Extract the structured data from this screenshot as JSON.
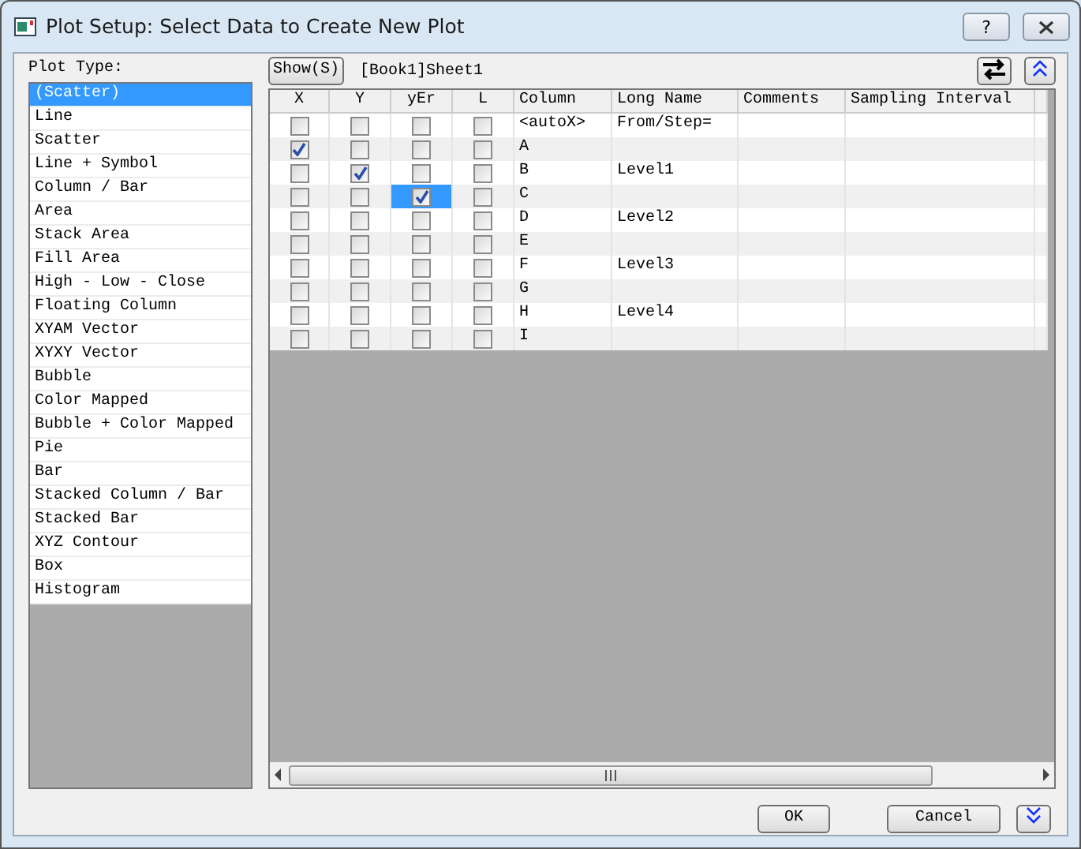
{
  "window": {
    "title": "Plot Setup: Select Data to Create New Plot",
    "help_button": "?"
  },
  "plot_type": {
    "label": "Plot Type:",
    "items": [
      {
        "label": "(Scatter)",
        "selected": true
      },
      {
        "label": "Line",
        "selected": false
      },
      {
        "label": "Scatter",
        "selected": false
      },
      {
        "label": "Line + Symbol",
        "selected": false
      },
      {
        "label": "Column / Bar",
        "selected": false
      },
      {
        "label": "Area",
        "selected": false
      },
      {
        "label": "Stack Area",
        "selected": false
      },
      {
        "label": "Fill Area",
        "selected": false
      },
      {
        "label": "High - Low - Close",
        "selected": false
      },
      {
        "label": "Floating Column",
        "selected": false
      },
      {
        "label": "XYAM Vector",
        "selected": false
      },
      {
        "label": "XYXY Vector",
        "selected": false
      },
      {
        "label": "Bubble",
        "selected": false
      },
      {
        "label": "Color Mapped",
        "selected": false
      },
      {
        "label": "Bubble + Color Mapped",
        "selected": false
      },
      {
        "label": "Pie",
        "selected": false
      },
      {
        "label": "Bar",
        "selected": false
      },
      {
        "label": "Stacked Column / Bar",
        "selected": false
      },
      {
        "label": "Stacked Bar",
        "selected": false
      },
      {
        "label": "XYZ Contour",
        "selected": false
      },
      {
        "label": "Box",
        "selected": false
      },
      {
        "label": "Histogram",
        "selected": false
      }
    ]
  },
  "toolbar": {
    "show_button": "Show(S)",
    "sheet": "[Book1]Sheet1"
  },
  "table": {
    "columns": [
      "X",
      "Y",
      "yEr",
      "L",
      "Column",
      "Long Name",
      "Comments",
      "Sampling Interval"
    ],
    "rows": [
      {
        "checks": [
          {
            "checked": false,
            "selected": false
          },
          {
            "checked": false,
            "selected": false
          },
          {
            "checked": false,
            "selected": false
          },
          {
            "checked": false,
            "selected": false
          }
        ],
        "column": "<autoX>",
        "long_name": "From/Step="
      },
      {
        "checks": [
          {
            "checked": true,
            "selected": false
          },
          {
            "checked": false,
            "selected": false
          },
          {
            "checked": false,
            "selected": false
          },
          {
            "checked": false,
            "selected": false
          }
        ],
        "column": "A",
        "long_name": ""
      },
      {
        "checks": [
          {
            "checked": false,
            "selected": false
          },
          {
            "checked": true,
            "selected": false
          },
          {
            "checked": false,
            "selected": false
          },
          {
            "checked": false,
            "selected": false
          }
        ],
        "column": "B",
        "long_name": "Level1"
      },
      {
        "checks": [
          {
            "checked": false,
            "selected": false
          },
          {
            "checked": false,
            "selected": false
          },
          {
            "checked": true,
            "selected": true
          },
          {
            "checked": false,
            "selected": false
          }
        ],
        "column": "C",
        "long_name": ""
      },
      {
        "checks": [
          {
            "checked": false,
            "selected": false
          },
          {
            "checked": false,
            "selected": false
          },
          {
            "checked": false,
            "selected": false
          },
          {
            "checked": false,
            "selected": false
          }
        ],
        "column": "D",
        "long_name": "Level2"
      },
      {
        "checks": [
          {
            "checked": false,
            "selected": false
          },
          {
            "checked": false,
            "selected": false
          },
          {
            "checked": false,
            "selected": false
          },
          {
            "checked": false,
            "selected": false
          }
        ],
        "column": "E",
        "long_name": ""
      },
      {
        "checks": [
          {
            "checked": false,
            "selected": false
          },
          {
            "checked": false,
            "selected": false
          },
          {
            "checked": false,
            "selected": false
          },
          {
            "checked": false,
            "selected": false
          }
        ],
        "column": "F",
        "long_name": "Level3"
      },
      {
        "checks": [
          {
            "checked": false,
            "selected": false
          },
          {
            "checked": false,
            "selected": false
          },
          {
            "checked": false,
            "selected": false
          },
          {
            "checked": false,
            "selected": false
          }
        ],
        "column": "G",
        "long_name": ""
      },
      {
        "checks": [
          {
            "checked": false,
            "selected": false
          },
          {
            "checked": false,
            "selected": false
          },
          {
            "checked": false,
            "selected": false
          },
          {
            "checked": false,
            "selected": false
          }
        ],
        "column": "H",
        "long_name": "Level4"
      },
      {
        "checks": [
          {
            "checked": false,
            "selected": false
          },
          {
            "checked": false,
            "selected": false
          },
          {
            "checked": false,
            "selected": false
          },
          {
            "checked": false,
            "selected": false
          }
        ],
        "column": "I",
        "long_name": ""
      }
    ]
  },
  "buttons": {
    "ok": "OK",
    "cancel": "Cancel"
  }
}
